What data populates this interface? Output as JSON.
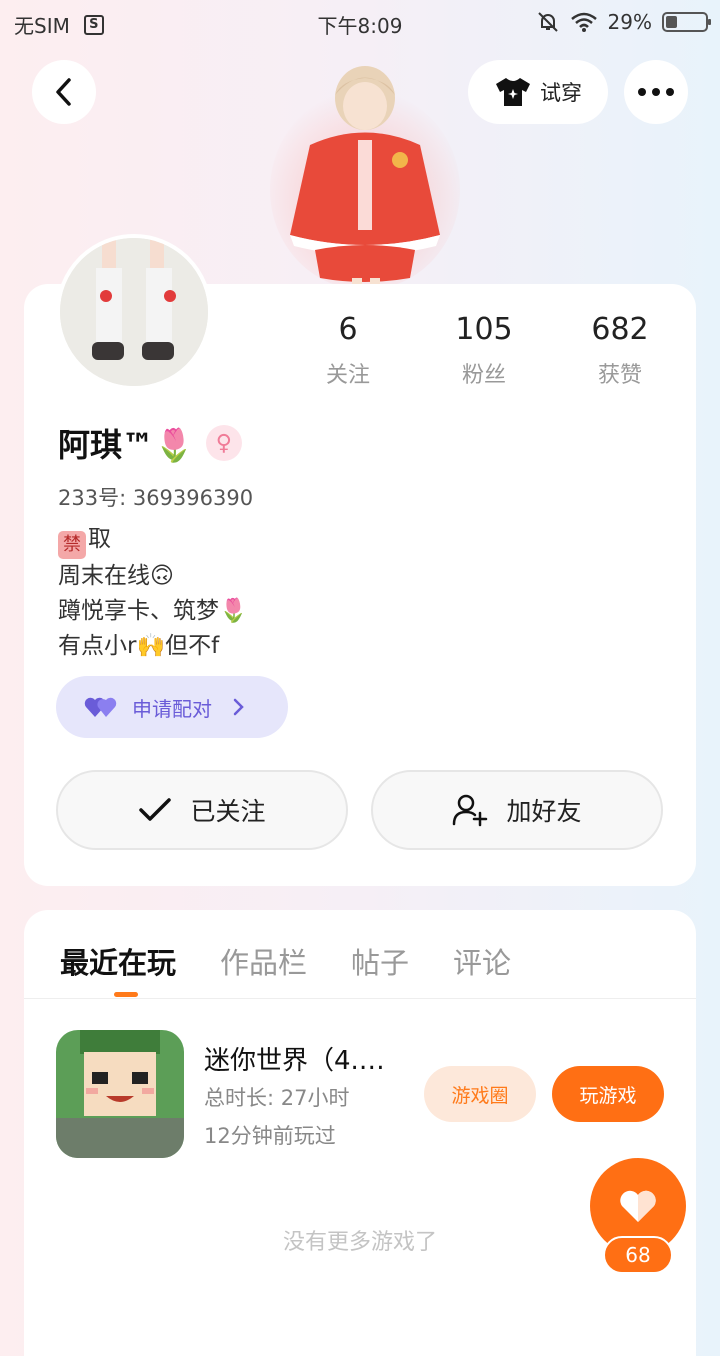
{
  "status_bar": {
    "carrier": "无SIM",
    "time": "下午8:09",
    "battery": "29%",
    "battery_level": 0.29,
    "icons": [
      "sim-s-icon",
      "mute-bell-icon",
      "wifi-icon",
      "battery-icon"
    ]
  },
  "nav": {
    "back_icon": "chevron-left-icon",
    "tryon_label": "试穿",
    "tryon_icon": "tshirt-icon",
    "more_icon": "more-dots-icon"
  },
  "profile": {
    "stats": [
      {
        "num": "6",
        "label": "关注"
      },
      {
        "num": "105",
        "label": "粉丝"
      },
      {
        "num": "682",
        "label": "获赞"
      }
    ],
    "username": "阿琪™🌷",
    "gender_icon": "female-icon",
    "user_id": "233号: 369396390",
    "bio": {
      "line1_badge": "禁",
      "line1_text": "取",
      "line2": "周末在线🙃",
      "line3": "蹲悦享卡、筑梦🌷",
      "line4": "有点小r🙌但不f"
    },
    "pair_label": "申请配对",
    "follow_label": "已关注",
    "add_friend_label": "加好友"
  },
  "tabs": {
    "items": [
      "最近在玩",
      "作品栏",
      "帖子",
      "评论"
    ],
    "active": 0
  },
  "recent_game": {
    "title": "迷你世界（4.…",
    "duration": "总时长: 27小时",
    "last_played": "12分钟前玩过",
    "circle_label": "游戏圈",
    "play_label": "玩游戏"
  },
  "no_more_text": "没有更多游戏了",
  "like": {
    "count": "68",
    "icon": "heart-icon"
  },
  "colors": {
    "accent": "#ff6f14",
    "pair": "#6a5cd8",
    "pair_bg": "#e6e6fb"
  }
}
